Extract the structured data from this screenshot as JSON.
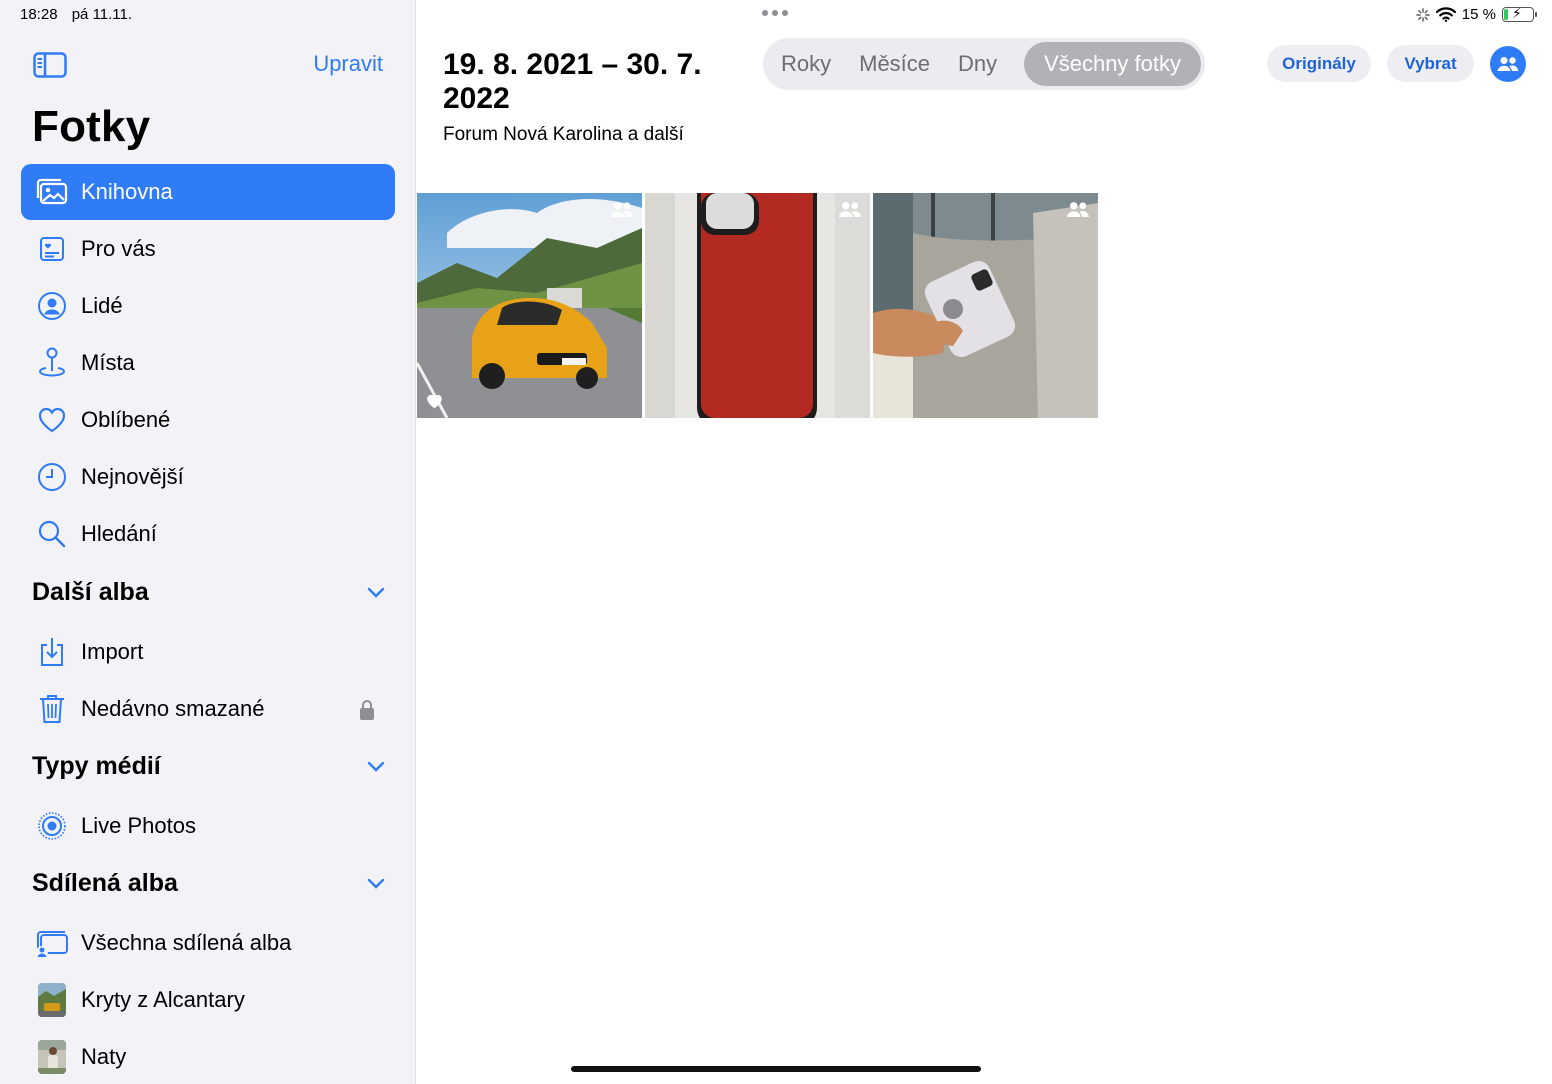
{
  "status_bar": {
    "time": "18:28",
    "date": "pá 11.11.",
    "battery": "15 %",
    "battery_level": 0.15
  },
  "sidebar": {
    "edit_label": "Upravit",
    "title": "Fotky",
    "items": [
      {
        "label": "Knihovna",
        "icon": "library-icon",
        "active": true
      },
      {
        "label": "Pro vás",
        "icon": "for-you-icon"
      },
      {
        "label": "Lidé",
        "icon": "people-icon"
      },
      {
        "label": "Místa",
        "icon": "places-icon"
      },
      {
        "label": "Oblíbené",
        "icon": "heart-icon"
      },
      {
        "label": "Nejnovější",
        "icon": "clock-icon"
      },
      {
        "label": "Hledání",
        "icon": "search-icon"
      }
    ],
    "sections": [
      {
        "title": "Další alba",
        "items": [
          {
            "label": "Import",
            "icon": "import-icon"
          },
          {
            "label": "Nedávno smazané",
            "icon": "trash-icon",
            "locked": true
          }
        ]
      },
      {
        "title": "Typy médií",
        "items": [
          {
            "label": "Live Photos",
            "icon": "live-photos-icon"
          }
        ]
      },
      {
        "title": "Sdílená alba",
        "items": [
          {
            "label": "Všechna sdílená alba",
            "icon": "shared-albums-icon"
          },
          {
            "label": "Kryty z Alcantary",
            "icon": "album-thumbnail"
          },
          {
            "label": "Naty",
            "icon": "album-thumbnail"
          }
        ]
      }
    ]
  },
  "main": {
    "date_range": "19. 8. 2021 – 30. 7. 2022",
    "location": "Forum Nová Karolina a další",
    "segments": [
      "Roky",
      "Měsíce",
      "Dny",
      "Všechny fotky"
    ],
    "selected_segment": "Všechny fotky",
    "originals_label": "Originály",
    "select_label": "Vybrat",
    "photos": [
      {
        "subject": "yellow car on mountain road",
        "shared": true,
        "favorite": true
      },
      {
        "subject": "red phone case",
        "shared": true,
        "favorite": false
      },
      {
        "subject": "hand holding phone in store",
        "shared": true,
        "favorite": false
      }
    ]
  }
}
